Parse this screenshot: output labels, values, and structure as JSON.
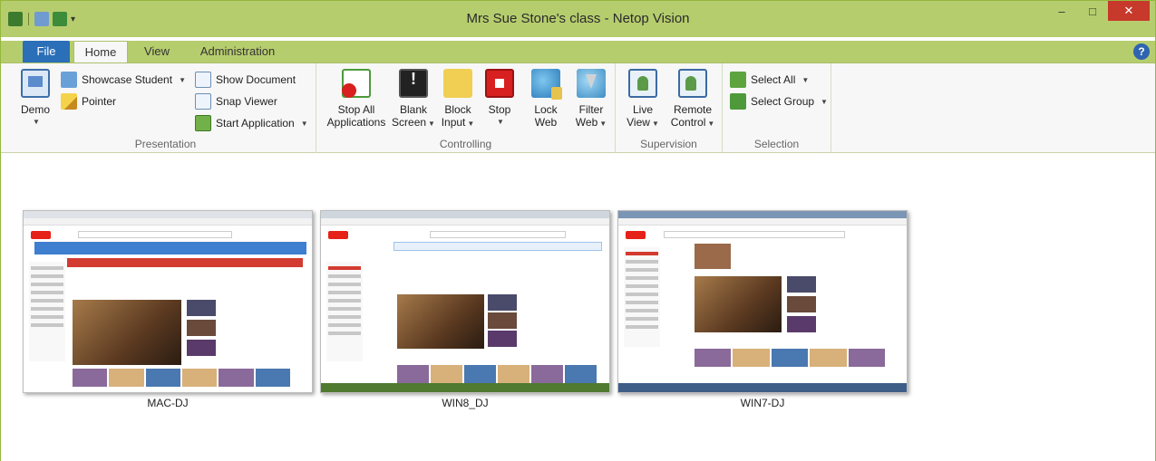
{
  "window": {
    "title": "Mrs Sue Stone's class - Netop Vision",
    "controls": {
      "minimize": "–",
      "maximize": "□",
      "close": "✕"
    }
  },
  "quick_access": {
    "dropdown": "▾"
  },
  "tabs": [
    {
      "label": "File"
    },
    {
      "label": "Home"
    },
    {
      "label": "View"
    },
    {
      "label": "Administration"
    }
  ],
  "help_label": "?",
  "ribbon": {
    "presentation": {
      "label": "Presentation",
      "demo": "Demo",
      "showcase_student": "Showcase Student",
      "pointer": "Pointer",
      "show_document": "Show Document",
      "snap_viewer": "Snap Viewer",
      "start_application": "Start Application"
    },
    "controlling": {
      "label": "Controlling",
      "stop_all_1": "Stop All",
      "stop_all_2": "Applications",
      "blank_1": "Blank",
      "blank_2": "Screen",
      "block_1": "Block",
      "block_2": "Input",
      "stop": "Stop",
      "lock_1": "Lock",
      "lock_2": "Web",
      "filter_1": "Filter",
      "filter_2": "Web"
    },
    "supervision": {
      "label": "Supervision",
      "live_1": "Live",
      "live_2": "View",
      "remote_1": "Remote",
      "remote_2": "Control"
    },
    "selection": {
      "label": "Selection",
      "select_all": "Select All",
      "select_group": "Select Group"
    }
  },
  "students": [
    {
      "name": "MAC-DJ"
    },
    {
      "name": "WIN8_DJ"
    },
    {
      "name": "WIN7-DJ"
    }
  ],
  "colors": {
    "titlebar": "#b6cd6e",
    "file_tab": "#2b6fb8",
    "close_button": "#c7392b"
  }
}
